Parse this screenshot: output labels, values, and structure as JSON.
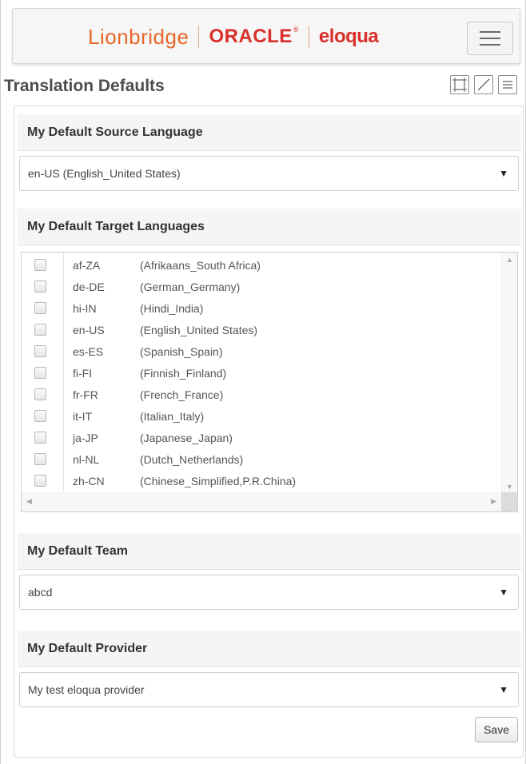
{
  "header": {
    "logo": {
      "lionbridge": "Lionbridge",
      "oracle": "ORACLE",
      "oracle_mark": "®",
      "eloqua": "eloqua",
      "eloqua_mark": "."
    },
    "menu_icon": "hamburger-menu-icon"
  },
  "page": {
    "title": "Translation Defaults",
    "icons": [
      "expand-icon",
      "resize-icon",
      "list-icon"
    ]
  },
  "source_language": {
    "heading": "My Default Source Language",
    "selected": "en-US  (English_United States)"
  },
  "target_languages": {
    "heading": "My Default Target Languages",
    "items": [
      {
        "code": "af-ZA",
        "name": "(Afrikaans_South Africa)",
        "checked": false
      },
      {
        "code": "de-DE",
        "name": "(German_Germany)",
        "checked": false
      },
      {
        "code": "hi-IN",
        "name": "(Hindi_India)",
        "checked": false
      },
      {
        "code": "en-US",
        "name": "(English_United States)",
        "checked": false
      },
      {
        "code": "es-ES",
        "name": "(Spanish_Spain)",
        "checked": false
      },
      {
        "code": "fi-FI",
        "name": "(Finnish_Finland)",
        "checked": false
      },
      {
        "code": "fr-FR",
        "name": "(French_France)",
        "checked": false
      },
      {
        "code": "it-IT",
        "name": "(Italian_Italy)",
        "checked": false
      },
      {
        "code": "ja-JP",
        "name": "(Japanese_Japan)",
        "checked": false
      },
      {
        "code": "nl-NL",
        "name": "(Dutch_Netherlands)",
        "checked": false
      },
      {
        "code": "zh-CN",
        "name": "(Chinese_Simplified,P.R.China)",
        "checked": false
      }
    ]
  },
  "team": {
    "heading": "My Default Team",
    "selected": "abcd"
  },
  "provider": {
    "heading": "My Default Provider",
    "selected": "My test eloqua provider"
  },
  "actions": {
    "save_label": "Save"
  },
  "colors": {
    "lionbridge_orange": "#e8672a",
    "oracle_red": "#d9302a",
    "header_bg": "#f6f6f6",
    "section_bg": "#f5f5f5"
  }
}
